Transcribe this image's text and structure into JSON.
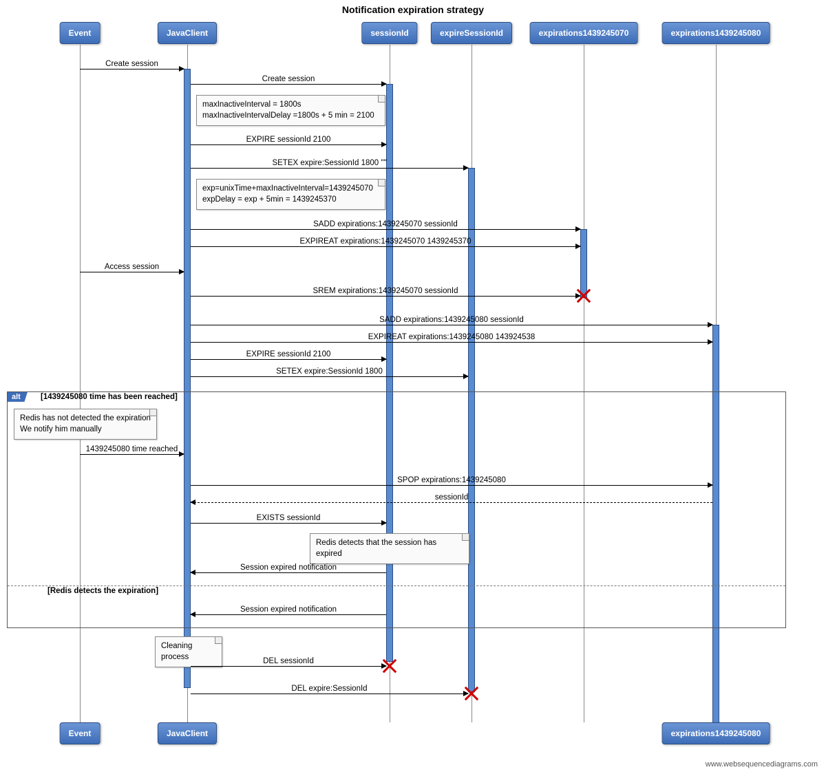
{
  "title": "Notification expiration strategy",
  "participants": {
    "event": "Event",
    "javaclient": "JavaClient",
    "sessionid": "sessionId",
    "expiresessionid": "expireSessionId",
    "exp70": "expirations1439245070",
    "exp80": "expirations1439245080"
  },
  "notes": {
    "n1a": "maxInactiveInterval = 1800s",
    "n1b": "maxInactiveIntervalDelay =1800s + 5 min = 2100",
    "n2a": "exp=unixTime+maxInactiveInterval=1439245070",
    "n2b": "expDelay = exp + 5min = 1439245370",
    "n3a": "Redis has not detected the expiration",
    "n3b": "We notify him manually",
    "n4": "Redis detects that the session has expired",
    "n5": "Cleaning process"
  },
  "messages": {
    "m1": "Create session",
    "m2": "Create session",
    "m3": "EXPIRE sessionId 2100",
    "m4": "SETEX expire:SessionId 1800 \"\"",
    "m5": "SADD expirations:1439245070 sessionId",
    "m6": "EXPIREAT expirations:1439245070 1439245370",
    "m7": "Access session",
    "m8": "SREM expirations:1439245070 sessionId",
    "m9": "SADD expirations:1439245080 sessionId",
    "m10": "EXPIREAT expirations:1439245080 143924538",
    "m11": "EXPIRE sessionId 2100",
    "m12": "SETEX expire:SessionId 1800",
    "m13": "1439245080 time reached",
    "m14": "SPOP expirations:1439245080",
    "m15": "sessionId",
    "m16": "EXISTS sessionId",
    "m17": "Session expired notification",
    "m18": "Session expired notification",
    "m19": "DEL sessionId",
    "m20": "DEL expire:SessionId"
  },
  "alt": {
    "tag": "alt",
    "cond1": "[1439245080 time has been reached]",
    "cond2": "[Redis detects the expiration]"
  },
  "footer": "www.websequencediagrams.com"
}
